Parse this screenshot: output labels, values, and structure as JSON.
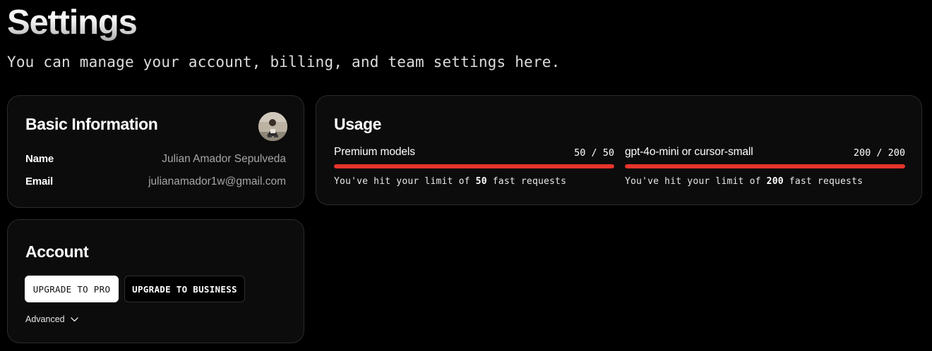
{
  "page": {
    "title": "Settings",
    "subtitle": "You can manage your account, billing, and team settings here."
  },
  "basic_info": {
    "title": "Basic Information",
    "name_label": "Name",
    "name_value": "Julian Amador Sepulveda",
    "email_label": "Email",
    "email_value": "julianamador1w@gmail.com",
    "avatar_icon": "user-avatar-photo"
  },
  "account": {
    "title": "Account",
    "upgrade_pro_label": "UPGRADE TO PRO",
    "upgrade_business_label": "UPGRADE TO BUSINESS",
    "advanced_label": "Advanced",
    "advanced_icon": "chevron-down-icon"
  },
  "usage": {
    "title": "Usage",
    "meters": [
      {
        "name": "Premium models",
        "count_text": "50 / 50",
        "used": 50,
        "limit": 50,
        "note_prefix": "You've hit your limit of ",
        "note_number": "50",
        "note_suffix": " fast requests"
      },
      {
        "name": "gpt-4o-mini or cursor-small",
        "count_text": "200 / 200",
        "used": 200,
        "limit": 200,
        "note_prefix": "You've hit your limit of ",
        "note_number": "200",
        "note_suffix": " fast requests"
      }
    ]
  },
  "colors": {
    "background": "#000000",
    "card": "#0c0c0c",
    "meter_fill": "#e5352b",
    "muted_text": "#a6a6a6"
  }
}
